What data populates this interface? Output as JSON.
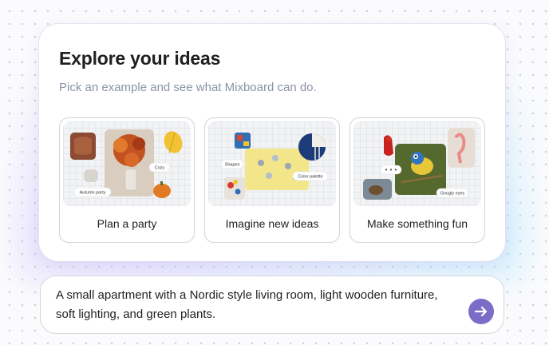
{
  "header": {
    "title": "Explore your ideas",
    "subtitle": "Pick an example and see what Mixboard can do."
  },
  "examples": [
    {
      "label": "Plan a party",
      "tags": [
        "Cozy",
        "Autumn party"
      ]
    },
    {
      "label": "Imagine new ideas",
      "tags": [
        "Shapes",
        "Color palette"
      ]
    },
    {
      "label": "Make something fun",
      "tags": [
        "Googly eyes"
      ]
    }
  ],
  "prompt": {
    "value": "A small apartment with a Nordic style living room, light wooden furniture, soft lighting, and green plants.",
    "send_icon": "arrow-right-icon"
  },
  "colors": {
    "accent": "#7d6cc7",
    "title": "#1f1f1f",
    "subtitle": "#8a94a6"
  }
}
